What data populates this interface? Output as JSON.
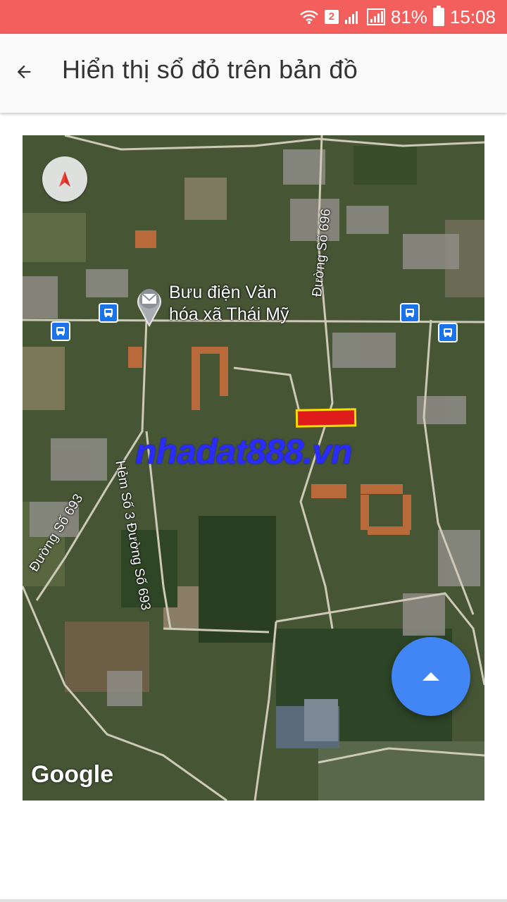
{
  "status_bar": {
    "sim_badge": "2",
    "battery": "81%",
    "time": "15:08"
  },
  "app_bar": {
    "title": "Hiển thị sổ đỏ trên bản đồ"
  },
  "map": {
    "poi_label_line1": "Bưu điện Văn",
    "poi_label_line2": "hóa xã Thái Mỹ",
    "road_labels": {
      "duong_696": "Đường Số 696",
      "duong_693": "Đường Số 693",
      "hem_3": "Hẻm Số 3 Đường Số 693"
    },
    "watermark": "nhadat888.vn",
    "attribution": "Google"
  },
  "colors": {
    "status_bar": "#f25f5c",
    "fab": "#4285f4",
    "parcel": "#e01b1b"
  }
}
